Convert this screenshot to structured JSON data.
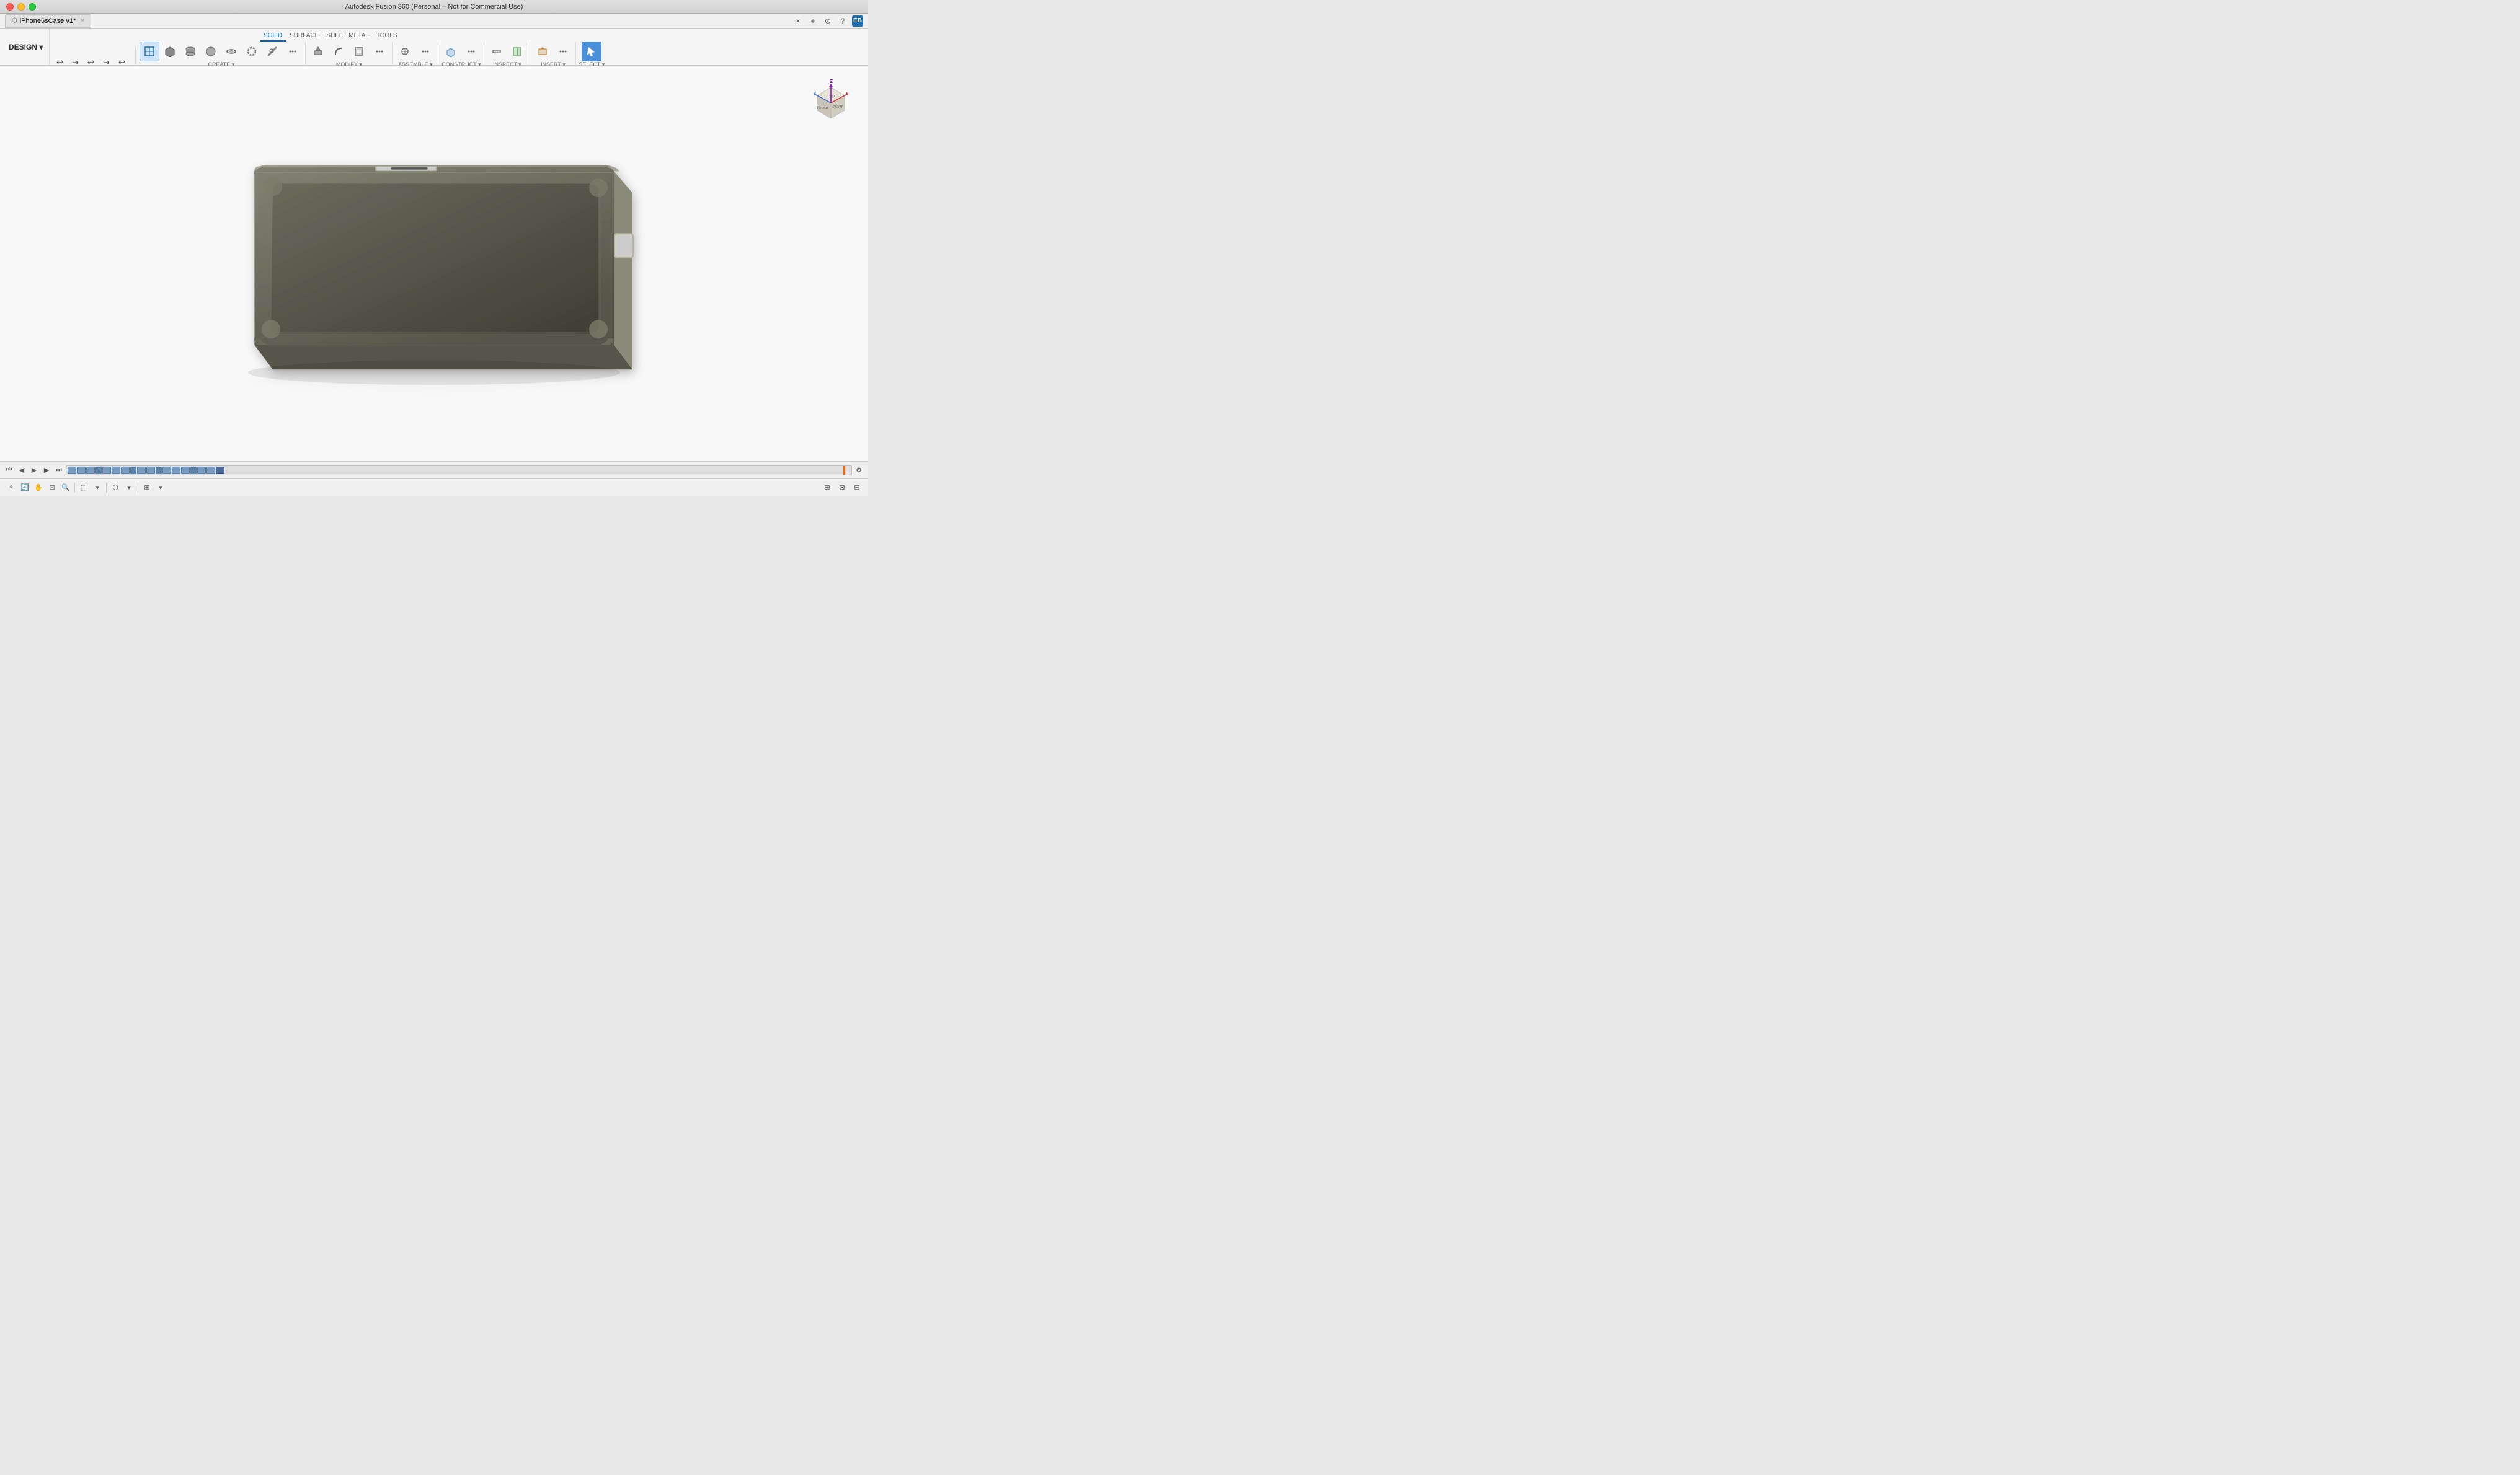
{
  "app": {
    "title": "Autodesk Fusion 360 (Personal – Not for Commercial Use)",
    "tab_name": "iPhone6sCase v1*",
    "close_char": "×"
  },
  "toolbar_tabs": [
    {
      "id": "solid",
      "label": "SOLID",
      "active": true
    },
    {
      "id": "surface",
      "label": "SURFACE",
      "active": false
    },
    {
      "id": "sheet_metal",
      "label": "SHEET METAL",
      "active": false
    },
    {
      "id": "tools",
      "label": "TOOLS",
      "active": false
    }
  ],
  "design_label": "DESIGN ▾",
  "toolbar_groups": [
    {
      "id": "create",
      "label": "CREATE ▾",
      "icons": [
        "⬚",
        "▣",
        "◉",
        "◇",
        "◫",
        "⬡",
        "↗",
        "⊕"
      ]
    },
    {
      "id": "modify",
      "label": "MODIFY ▾",
      "icons": [
        "▷",
        "◈",
        "⤢",
        "⬖"
      ]
    },
    {
      "id": "assemble",
      "label": "ASSEMBLE ▾",
      "icons": [
        "⊞",
        "⊠"
      ]
    },
    {
      "id": "construct",
      "label": "CONSTRUCT ▾",
      "icons": [
        "⬡",
        "▤"
      ]
    },
    {
      "id": "inspect",
      "label": "INSPECT ▾",
      "icons": [
        "⬡",
        "⊡"
      ]
    },
    {
      "id": "insert",
      "label": "INSERT ▾",
      "icons": [
        "⊡",
        "⊗"
      ]
    },
    {
      "id": "select",
      "label": "SELECT ▾",
      "icons": [
        "↖"
      ]
    }
  ],
  "undo_redo": [
    "↩",
    "↪",
    "↩",
    "↪",
    "↩"
  ],
  "statusbar_left": [
    "⊕",
    "⊠",
    "⌖",
    "✦",
    "⌕",
    "+",
    "⊟",
    "⊞",
    "⊞"
  ],
  "statusbar_right": [
    "⬚",
    "⬚",
    "⬚"
  ],
  "timeline_items": 18,
  "viewcube": {
    "label": "FRONT"
  }
}
